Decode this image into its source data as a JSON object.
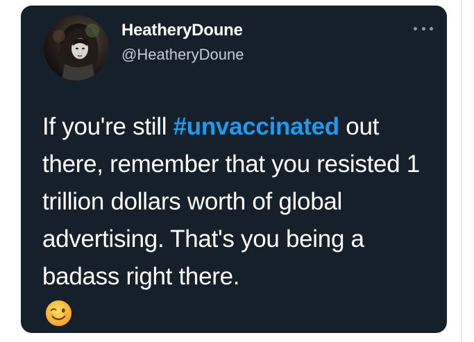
{
  "tweet": {
    "display_name": "HeatheryDoune",
    "handle": "@HeatheryDoune",
    "text_lead": "If you're still ",
    "hashtag": "#unvaccinated",
    "text_rest": " out there, remember that you resisted 1 trillion dollars worth of global advertising. That's you being a badass right there.",
    "emoji": "winking-face-emoji",
    "more_icon": "ellipsis-icon"
  },
  "colors": {
    "card_background": "#15202b",
    "hashtag": "#1d9bf0",
    "text": "#ffffff",
    "handle": "#c7ccd1"
  }
}
